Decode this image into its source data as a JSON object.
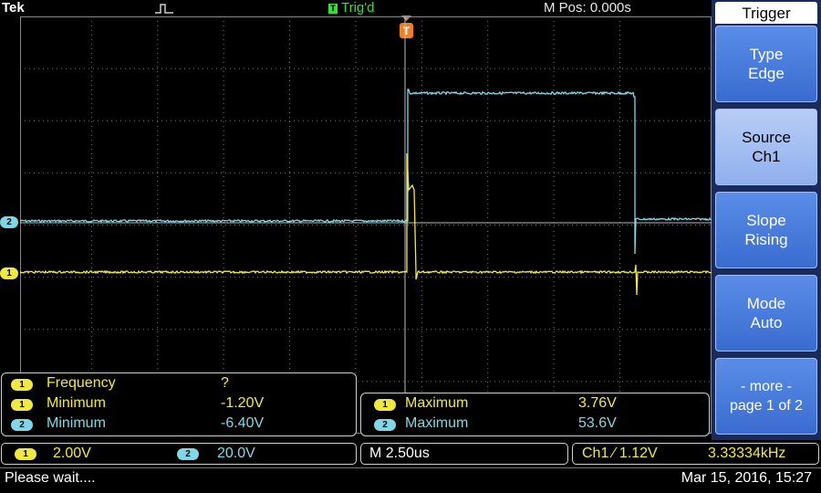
{
  "top": {
    "brand": "Tek",
    "trigger_state": "Trig'd",
    "trigger_badge": "T",
    "m_pos": "M Pos: 0.000s"
  },
  "channels": {
    "ch1_marker": "1",
    "ch2_marker": "2",
    "ch1_color": "#f2ea3a",
    "ch2_color": "#7fd8e8"
  },
  "menu": {
    "title": "Trigger",
    "items": [
      {
        "line1": "Type",
        "line2": "Edge"
      },
      {
        "line1": "Source",
        "line2": "Ch1"
      },
      {
        "line1": "Slope",
        "line2": "Rising"
      },
      {
        "line1": "Mode",
        "line2": "Auto"
      },
      {
        "line1": "- more -",
        "line2": "page 1 of 2"
      }
    ]
  },
  "measurements": {
    "left": [
      {
        "ch": "1",
        "label": "Frequency",
        "value": "?"
      },
      {
        "ch": "1",
        "label": "Minimum",
        "value": "-1.20V"
      },
      {
        "ch": "2",
        "label": "Minimum",
        "value": "-6.40V"
      }
    ],
    "right": [
      {
        "ch": "1",
        "label": "Maximum",
        "value": "3.76V"
      },
      {
        "ch": "2",
        "label": "Maximum",
        "value": "53.6V"
      }
    ]
  },
  "bottom": {
    "ch1_scale": "2.00V",
    "ch2_scale": "20.0V",
    "timebase": "M 2.50us",
    "trigger_info": "Ch1 ∕ 1.12V",
    "trigger_freq": "3.33334kHz",
    "status_message": "Please wait....",
    "datetime": "Mar 15, 2016, 15:27"
  },
  "chart_data": {
    "type": "line",
    "title": "",
    "x_divisions": 10,
    "y_divisions": 8,
    "grid": true,
    "series": [
      {
        "name": "Ch1",
        "note_units": "volts",
        "values": [
          0,
          0,
          0,
          0,
          3.76,
          -1.2,
          0,
          0,
          0
        ]
      },
      {
        "name": "Ch2",
        "note_units": "volts",
        "values": [
          0,
          0,
          0,
          0,
          53.6,
          53.6,
          53.6,
          0,
          0
        ]
      }
    ]
  }
}
